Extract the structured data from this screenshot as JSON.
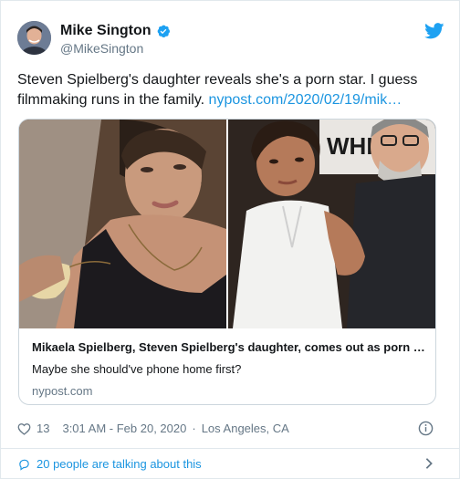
{
  "user": {
    "name": "Mike Sington",
    "handle": "@MikeSington"
  },
  "tweet": {
    "text": "Steven Spielberg's daughter reveals she's a porn star. I guess filmmaking runs in the family. ",
    "link": "nypost.com/2020/02/19/mik…"
  },
  "card": {
    "title": "Mikaela Spielberg, Steven Spielberg's daughter, comes out as porn …",
    "description": "Maybe she should've phone home first?",
    "domain": "nypost.com",
    "backdrop_text": "WHIP I"
  },
  "meta": {
    "likes": "13",
    "time": "3:01 AM - Feb 20, 2020",
    "separator": "·",
    "location": "Los Angeles, CA"
  },
  "footer": {
    "talking": "20 people are talking about this"
  },
  "colors": {
    "accent": "#1b95e0",
    "verified": "#1da1f2",
    "muted": "#657786"
  }
}
